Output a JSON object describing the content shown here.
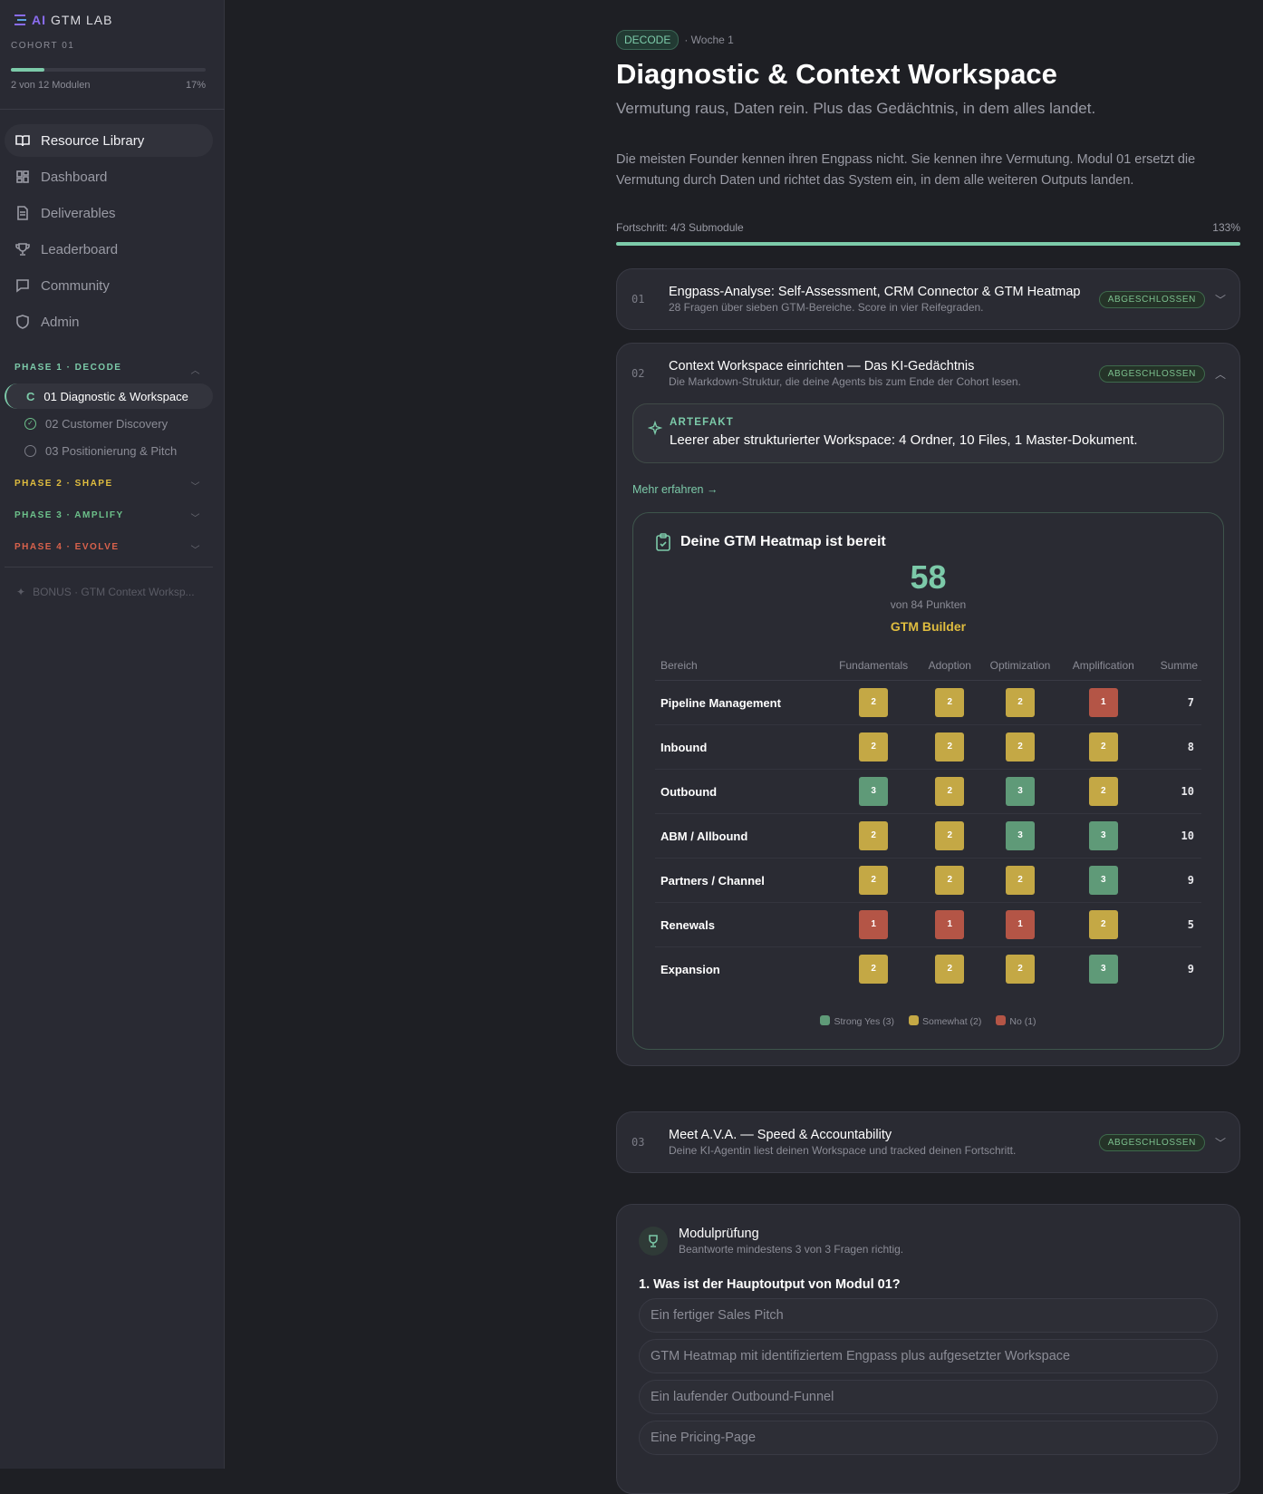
{
  "sidebar": {
    "logo_ai": "AI",
    "logo_text": "GTM LAB",
    "cohort": "COHORT 01",
    "progress_percent": 17,
    "progress_label": "2 von 12 Modulen",
    "progress_pct_text": "17%",
    "nav": [
      {
        "label": "Resource Library",
        "icon": "book-icon"
      },
      {
        "label": "Dashboard",
        "icon": "grid-icon"
      },
      {
        "label": "Deliverables",
        "icon": "file-icon"
      },
      {
        "label": "Leaderboard",
        "icon": "trophy-icon"
      },
      {
        "label": "Community",
        "icon": "chat-icon"
      },
      {
        "label": "Admin",
        "icon": "shield-icon"
      }
    ],
    "phases": [
      {
        "label": "PHASE 1 · DECODE",
        "color": "#7ccaa9"
      },
      {
        "label": "PHASE 2 · SHAPE",
        "color": "#e0bd3f"
      },
      {
        "label": "PHASE 3 · AMPLIFY",
        "color": "#6cc08a"
      },
      {
        "label": "PHASE 4 · EVOLVE",
        "color": "#d9624c"
      }
    ],
    "submodules": [
      {
        "label": "01 Diagnostic & Workspace",
        "state": "in-progress"
      },
      {
        "label": "02 Customer Discovery",
        "state": "done"
      },
      {
        "label": "03 Positionierung & Pitch",
        "state": "open"
      }
    ],
    "bonus": "BONUS · GTM Context Worksp..."
  },
  "header": {
    "badge": "DECODE",
    "week": "· Woche 1",
    "title": "Diagnostic & Context Workspace",
    "subtitle": "Vermutung raus, Daten rein. Plus das Gedächtnis, in dem alles landet.",
    "intro": "Die meisten Founder kennen ihren Engpass nicht. Sie kennen ihre Vermutung. Modul 01 ersetzt die Vermutung durch Daten und richtet das System ein, in dem alle weiteren Outputs landen.",
    "progress_label": "Fortschritt: 4/3 Submodule",
    "progress_pct": "133%"
  },
  "modules": [
    {
      "num": "01",
      "title": "Engpass-Analyse: Self-Assessment, CRM Connector & GTM Heatmap",
      "desc": "28 Fragen über sieben GTM-Bereiche. Score in vier Reifegraden.",
      "status": "ABGESCHLOSSEN"
    },
    {
      "num": "02",
      "title": "Context Workspace einrichten — Das KI-Gedächtnis",
      "desc": "Die Markdown-Struktur, die deine Agents bis zum Ende der Cohort lesen.",
      "status": "ABGESCHLOSSEN",
      "artefakt_label": "ARTEFAKT",
      "artefakt_text": "Leerer aber strukturierter Workspace: 4 Ordner, 10 Files, 1 Master-Dokument.",
      "more": "Mehr erfahren →"
    },
    {
      "num": "03",
      "title": "Meet A.V.A. — Speed & Accountability",
      "desc": "Deine KI-Agentin liest deinen Workspace und tracked deinen Fortschritt.",
      "status": "ABGESCHLOSSEN"
    }
  ],
  "heatmap": {
    "title": "Deine GTM Heatmap ist bereit",
    "score": "58",
    "of": "von 84 Punkten",
    "level": "GTM Builder",
    "columns": [
      "Bereich",
      "Fundamentals",
      "Adoption",
      "Optimization",
      "Amplification",
      "Summe"
    ],
    "rows": [
      {
        "area": "Pipeline Management",
        "values": [
          2,
          2,
          2,
          1
        ],
        "sum": "7"
      },
      {
        "area": "Inbound",
        "values": [
          2,
          2,
          2,
          2
        ],
        "sum": "8"
      },
      {
        "area": "Outbound",
        "values": [
          3,
          2,
          3,
          2
        ],
        "sum": "10"
      },
      {
        "area": "ABM / Allbound",
        "values": [
          2,
          2,
          3,
          3
        ],
        "sum": "10"
      },
      {
        "area": "Partners / Channel",
        "values": [
          2,
          2,
          2,
          3
        ],
        "sum": "9"
      },
      {
        "area": "Renewals",
        "values": [
          1,
          1,
          1,
          2
        ],
        "sum": "5"
      },
      {
        "area": "Expansion",
        "values": [
          2,
          2,
          2,
          3
        ],
        "sum": "9"
      }
    ],
    "legend": [
      {
        "label": "Strong Yes (3)",
        "color": "#5f9a78"
      },
      {
        "label": "Somewhat (2)",
        "color": "#c4a845"
      },
      {
        "label": "No (1)",
        "color": "#b45546"
      }
    ]
  },
  "quiz": {
    "title": "Modulprüfung",
    "subtitle": "Beantworte mindestens 3 von 3 Fragen richtig.",
    "question": "1. Was ist der Hauptoutput von Modul 01?",
    "options": [
      "Ein fertiger Sales Pitch",
      "GTM Heatmap mit identifiziertem Engpass plus aufgesetzter Workspace",
      "Ein laufender Outbound-Funnel",
      "Eine Pricing-Page"
    ]
  }
}
